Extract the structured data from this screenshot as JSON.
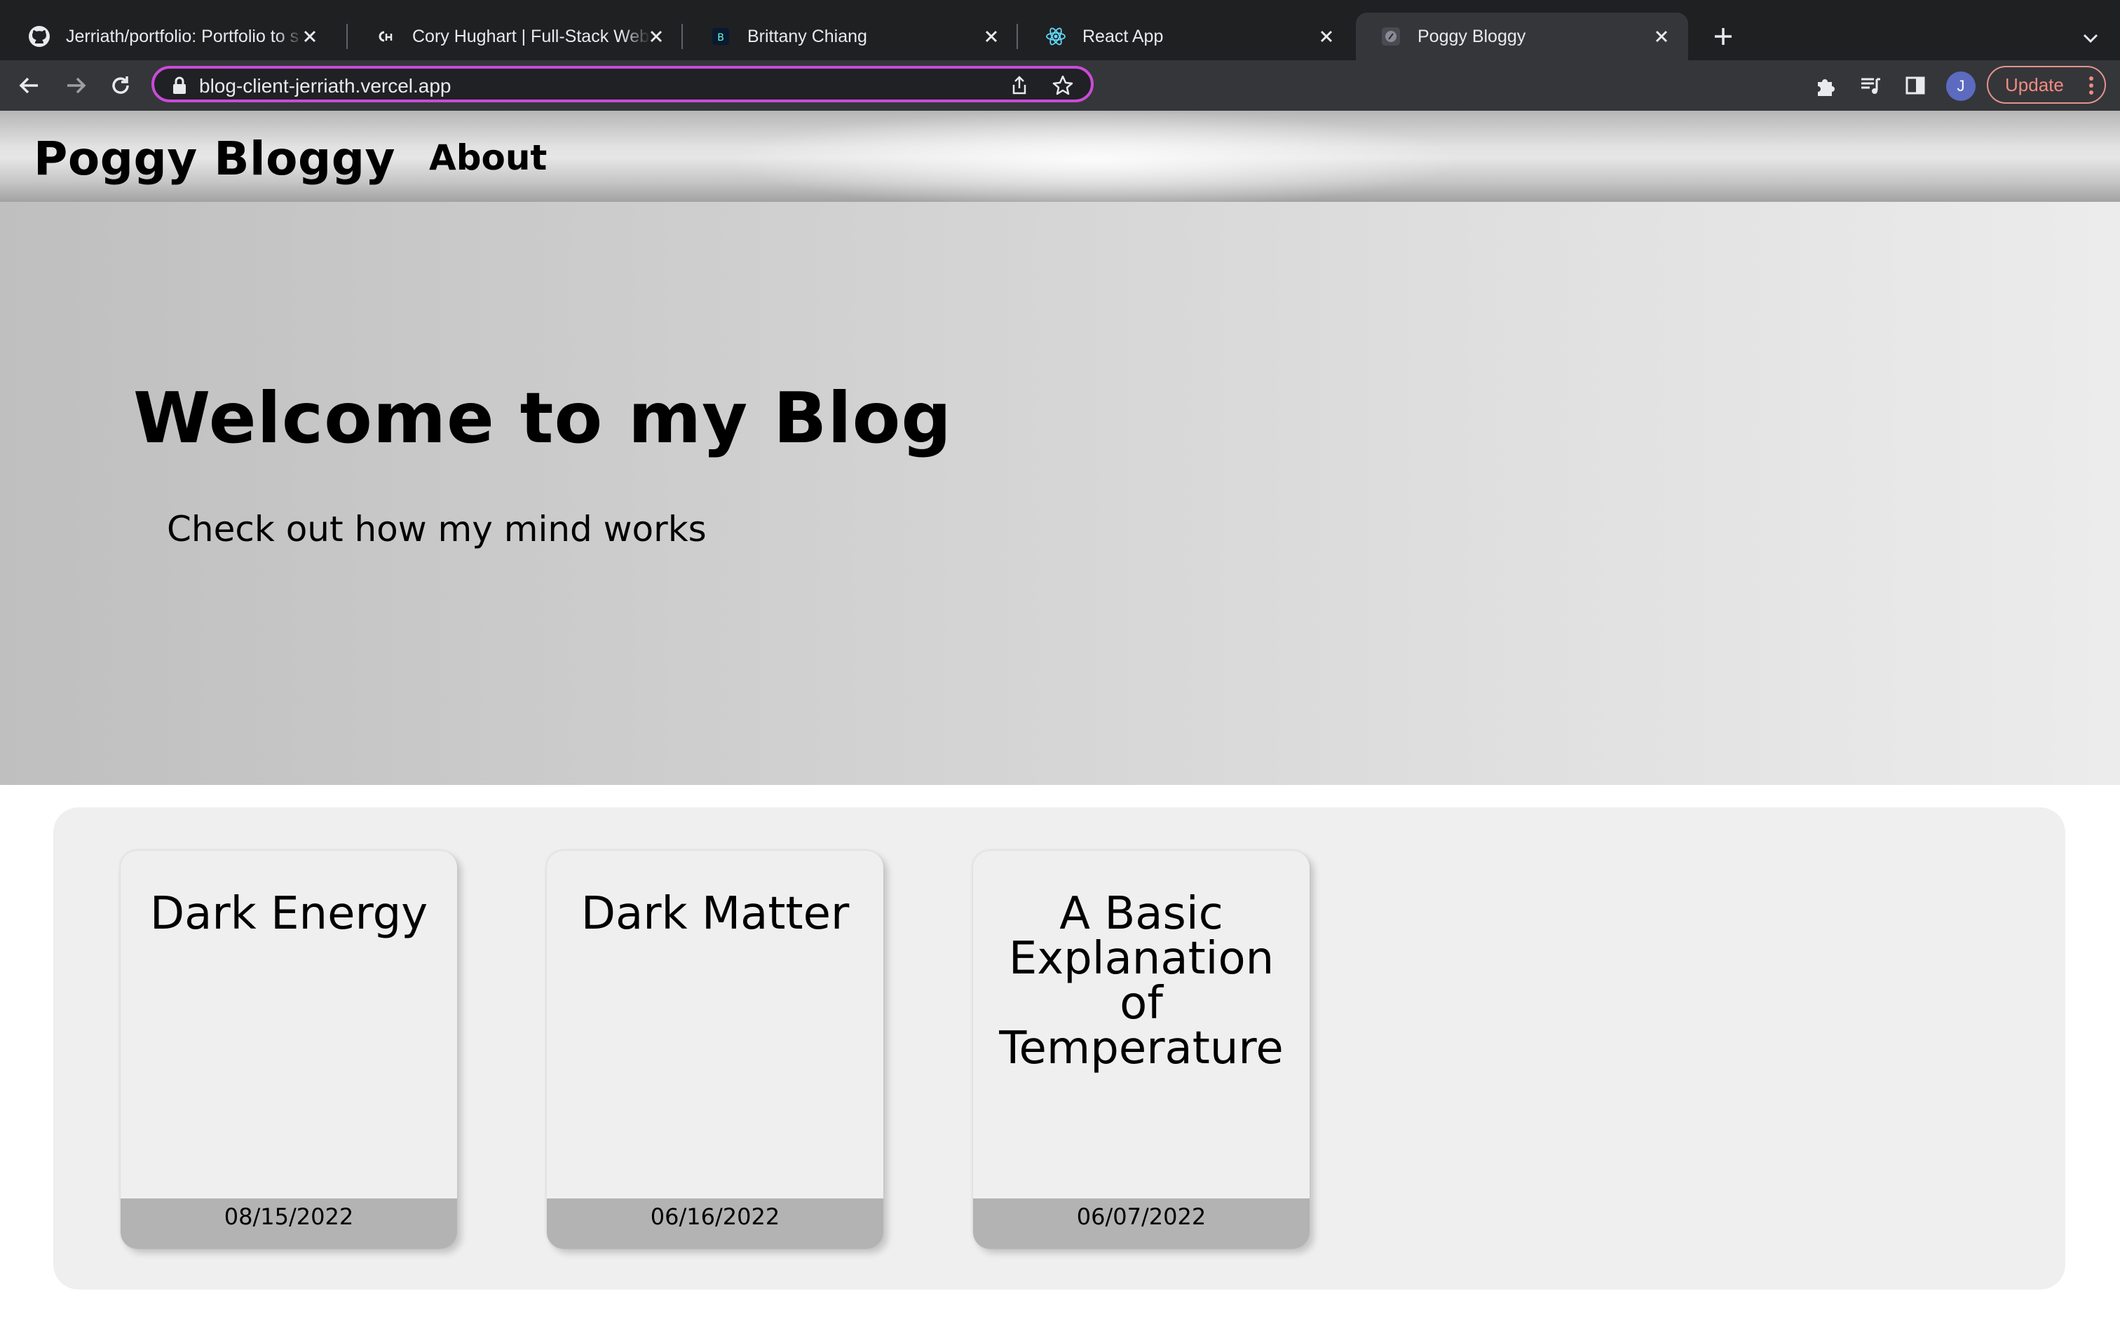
{
  "browser": {
    "tabs": [
      {
        "title": "Jerriath/portfolio: Portfolio to s",
        "icon": "github-icon",
        "active": false
      },
      {
        "title": "Cory Hughart | Full-Stack Web",
        "icon": "ch-logo-icon",
        "active": false
      },
      {
        "title": "Brittany Chiang",
        "icon": "b-logo-icon",
        "active": false
      },
      {
        "title": "React App",
        "icon": "react-icon",
        "active": false
      },
      {
        "title": "Poggy Bloggy",
        "icon": "site-favicon-icon",
        "active": true
      }
    ],
    "url": "blog-client-jerriath.vercel.app",
    "profile_initial": "J",
    "update_label": "Update",
    "accent_color": "#c94bd7"
  },
  "site": {
    "brand": "Poggy Bloggy",
    "nav": {
      "about": "About"
    },
    "hero": {
      "title": "Welcome to my Blog",
      "subtitle": "Check out how my mind works"
    },
    "posts": [
      {
        "title": "Dark Energy",
        "date": "08/15/2022"
      },
      {
        "title": "Dark Matter",
        "date": "06/16/2022"
      },
      {
        "title": "A Basic Explanation of Temperature",
        "date": "06/07/2022"
      }
    ]
  }
}
